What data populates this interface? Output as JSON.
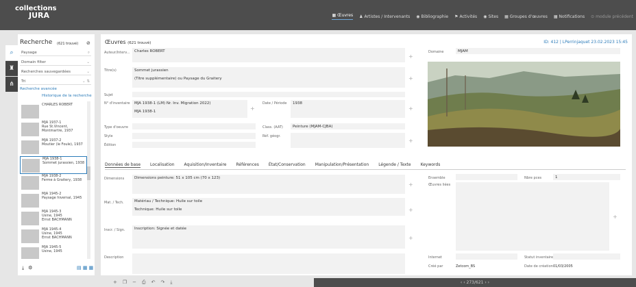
{
  "app": {
    "logo_line1": "collections",
    "logo_line2": "JURA"
  },
  "nav": [
    {
      "icon": "▦",
      "label": "Œuvres",
      "active": true
    },
    {
      "icon": "♟",
      "label": "Artistes / Intervenants"
    },
    {
      "icon": "◉",
      "label": "Bibliographie"
    },
    {
      "icon": "⚑",
      "label": "Activités"
    },
    {
      "icon": "◉",
      "label": "Sites"
    },
    {
      "icon": "▦",
      "label": "Groupes d'œuvres"
    },
    {
      "icon": "▦",
      "label": "Notifications"
    },
    {
      "icon": "⊙",
      "label": "module précédent",
      "dim": true
    }
  ],
  "sidebar": {
    "title": "Recherche",
    "count": "(621 trouvé)",
    "clear": "⊘",
    "search_value": "Paysage",
    "domain_filter": "Domain filter",
    "saved_searches": "Recherches sauvegardées",
    "sort": "Tri",
    "advanced": "Recherche avancée",
    "history": "Historique de la recherche",
    "items": [
      {
        "text": "CHARLES ROBERT"
      },
      {
        "text": "MJA 1937-1\nRue St.Vincent, Montmartre, 1937"
      },
      {
        "text": "MJA 1937-2\nMoutier (le Foule), 1937"
      },
      {
        "text": "MJA 1938-1\nSommet jurassien, 1938",
        "selected": true
      },
      {
        "text": "MJA 1938-2\nFerme à Graitery, 1938"
      },
      {
        "text": "MJA 1945-2\nPaysage hivernal, 1945"
      },
      {
        "text": "MJA 1945-3\nUsine, 1945\nErnst BACHMANN"
      },
      {
        "text": "MJA 1945-4\nUsine, 1945\nErnst BACHMANN"
      },
      {
        "text": "MJA 1945-5\nUsine, 1945"
      }
    ]
  },
  "main": {
    "title": "Œuvres",
    "count": "(621 trouvé)",
    "meta": "ID: 412 | LPerrinjaquet 23.02.2023 15:45",
    "labels": {
      "author": "Auteur/Interv...",
      "title": "Titre(s)",
      "subject": "Sujet",
      "inventory": "N° d'inventaire",
      "date": "Date / Période",
      "type": "Type d'oeuvre",
      "class": "Class. (AAT)",
      "style": "Style",
      "geo": "Réf. géogr.",
      "edition": "Édition",
      "domain": "Domaine",
      "dimensions": "Dimensions",
      "material": "Mat. / Tech.",
      "inscription": "Inscr. / Sign.",
      "description": "Description",
      "ensemble": "Ensemble",
      "linked": "Œuvres liées",
      "pieces": "Nbre pces",
      "internet": "Internet",
      "status": "Statut inventaire",
      "created_by": "Créé par",
      "creation_date": "Date de création"
    },
    "values": {
      "author": "Charles ROBERT",
      "title1": "Sommet jurassien",
      "title2": "(Titre supplémentaire) ou Paysage du Graitery",
      "inv1": "MJA 1938-1 (LM) Nr. Inv. Migration 2022)",
      "inv2": "MJA 1938-1",
      "date": "1938",
      "class": "Peinture (MJAM-CJBA)",
      "domain": "MJAM",
      "dimensions": "Dimensions peinture: 51 x 105 cm (70 x 123)",
      "material1": "Matériau / Technique: Huile sur toile",
      "material2": "Technique: Huile sur toile",
      "inscription": "Inscription: Signée et datée",
      "pieces": "1",
      "created_by": "Zetcom_BS",
      "creation_date": "01/03/2005"
    },
    "subtabs": [
      "Données de base",
      "Localisation",
      "Aquisition/Inventaire",
      "Références",
      "État/Conservation",
      "Manipulation/Présentation",
      "Légende / Texte",
      "Keywords"
    ]
  },
  "bottom": {
    "pager": "‹  ‹  273/621  ›  ›"
  }
}
